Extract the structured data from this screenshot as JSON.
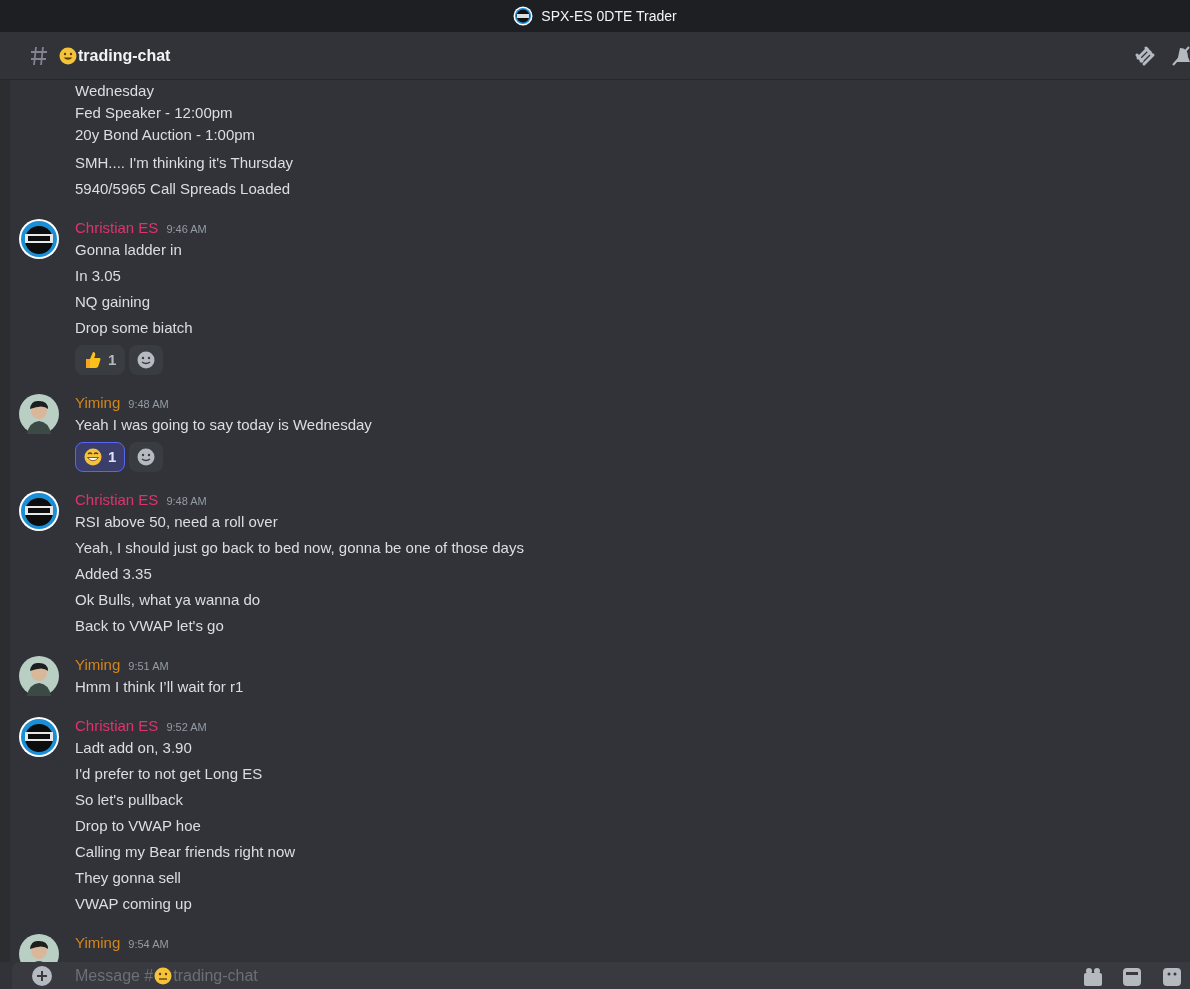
{
  "window": {
    "title": "SPX-ES 0DTE Trader"
  },
  "channel": {
    "name": "trading-chat"
  },
  "groups": [
    {
      "continuation": true,
      "messages": [
        {
          "lines": [
            "Wednesday",
            "Fed Speaker - 12:00pm",
            "20y Bond Auction - 1:00pm"
          ]
        },
        {
          "lines": [
            "SMH.... I'm thinking it's Thursday"
          ]
        },
        {
          "lines": [
            "5940/5965 Call Spreads Loaded"
          ]
        }
      ]
    },
    {
      "continuation": false,
      "author": "Christian ES",
      "color": "#e0336d",
      "avatar": {
        "kind": "logo"
      },
      "time": "9:46 AM",
      "messages": [
        {
          "lines": [
            "Gonna ladder in"
          ]
        },
        {
          "lines": [
            "In 3.05"
          ]
        },
        {
          "lines": [
            "NQ gaining"
          ]
        },
        {
          "lines": [
            "Drop some biatch"
          ]
        }
      ],
      "reactions": [
        {
          "kind": "thumbs-up",
          "count": "1",
          "selected": false
        }
      ]
    },
    {
      "continuation": false,
      "author": "Yiming",
      "color": "#d4861a",
      "avatar": {
        "kind": "person"
      },
      "time": "9:48 AM",
      "messages": [
        {
          "lines": [
            "Yeah I was going to say today is Wednesday"
          ]
        }
      ],
      "reactions": [
        {
          "kind": "grin",
          "count": "1",
          "selected": true
        }
      ]
    },
    {
      "continuation": false,
      "author": "Christian ES",
      "color": "#e0336d",
      "avatar": {
        "kind": "logo"
      },
      "time": "9:48 AM",
      "messages": [
        {
          "lines": [
            "RSI above 50, need a roll over"
          ]
        },
        {
          "lines": [
            "Yeah, I should just go back to bed now, gonna be one of those days"
          ]
        },
        {
          "lines": [
            "Added 3.35"
          ]
        },
        {
          "lines": [
            "Ok Bulls, what ya wanna do"
          ]
        },
        {
          "lines": [
            "Back to VWAP let's go"
          ]
        }
      ]
    },
    {
      "continuation": false,
      "author": "Yiming",
      "color": "#d4861a",
      "avatar": {
        "kind": "person"
      },
      "time": "9:51 AM",
      "messages": [
        {
          "lines": [
            "Hmm I think I’ll wait for r1"
          ]
        }
      ]
    },
    {
      "continuation": false,
      "author": "Christian ES",
      "color": "#e0336d",
      "avatar": {
        "kind": "logo"
      },
      "time": "9:52 AM",
      "messages": [
        {
          "lines": [
            "Ladt add on, 3.90"
          ]
        },
        {
          "lines": [
            "I'd prefer to not get Long ES"
          ]
        },
        {
          "lines": [
            "So let's pullback"
          ]
        },
        {
          "lines": [
            "Drop to VWAP hoe"
          ]
        },
        {
          "lines": [
            "Calling my Bear friends right now"
          ]
        },
        {
          "lines": [
            "They gonna sell"
          ]
        },
        {
          "lines": [
            "VWAP coming up"
          ]
        }
      ]
    },
    {
      "continuation": false,
      "author": "Yiming",
      "color": "#d4861a",
      "avatar": {
        "kind": "person"
      },
      "time": "9:54 AM"
    }
  ],
  "message_box": {
    "placeholder_before": "Message #",
    "placeholder_after": "trading-chat"
  }
}
